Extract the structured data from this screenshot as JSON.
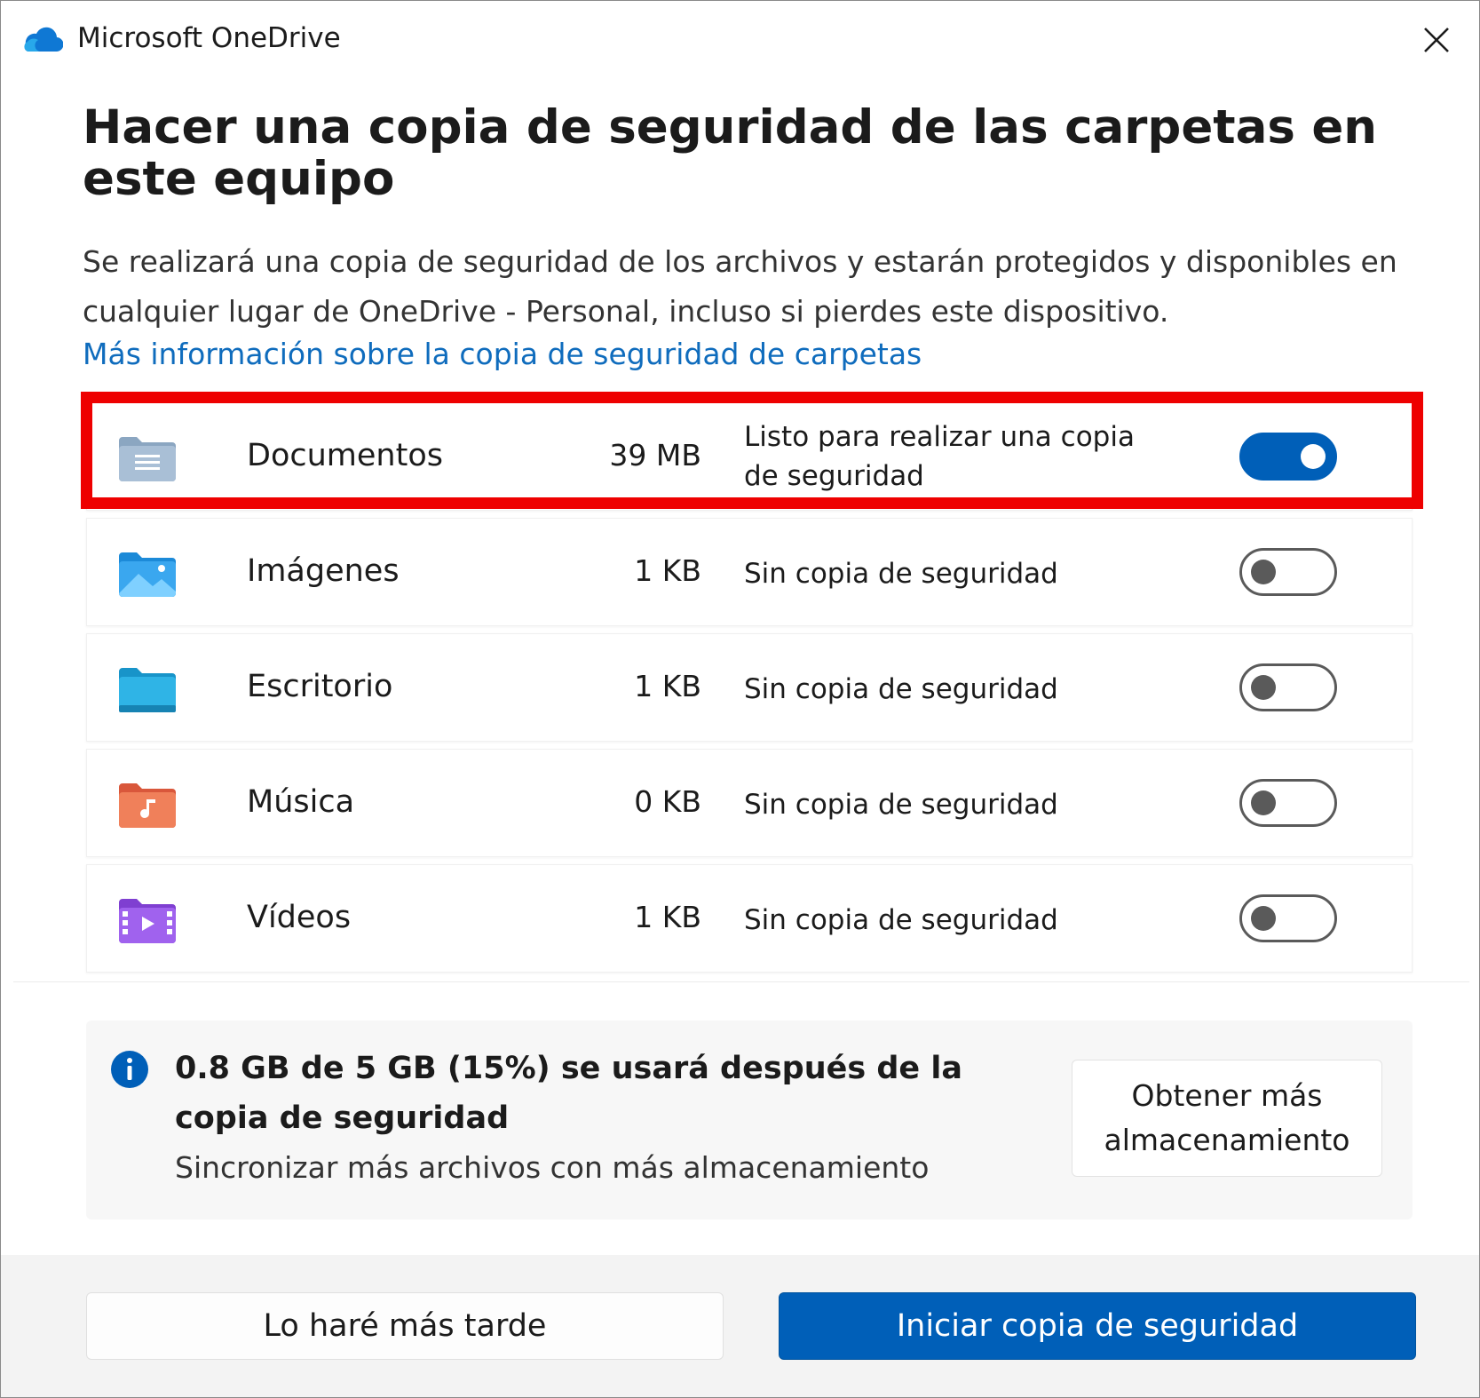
{
  "window": {
    "title": "Microsoft OneDrive",
    "close_icon": "close-icon",
    "app_icon": "onedrive-cloud-icon"
  },
  "header": {
    "title": "Hacer una copia de seguridad de las carpetas en este equipo",
    "description": "Se realizará una copia de seguridad de los archivos y estarán protegidos y disponibles en cualquier lugar de OneDrive - Personal, incluso si pierdes este dispositivo.",
    "link": "Más información sobre la copia de seguridad de carpetas"
  },
  "folders": [
    {
      "name": "Documentos",
      "size": "39 MB",
      "status": "Listo para realizar una copia de seguridad",
      "enabled": true,
      "icon": "documents-folder-icon",
      "highlighted": true
    },
    {
      "name": "Imágenes",
      "size": "1 KB",
      "status": "Sin copia de seguridad",
      "enabled": false,
      "icon": "pictures-folder-icon"
    },
    {
      "name": "Escritorio",
      "size": "1 KB",
      "status": "Sin copia de seguridad",
      "enabled": false,
      "icon": "desktop-folder-icon"
    },
    {
      "name": "Música",
      "size": "0 KB",
      "status": "Sin copia de seguridad",
      "enabled": false,
      "icon": "music-folder-icon"
    },
    {
      "name": "Vídeos",
      "size": "1 KB",
      "status": "Sin copia de seguridad",
      "enabled": false,
      "icon": "videos-folder-icon"
    }
  ],
  "storage": {
    "summary": "0.8 GB de 5 GB (15%) se usará después de la copia de seguridad",
    "hint": "Sincronizar más archivos con más almacenamiento",
    "button": "Obtener más almacenamiento",
    "icon": "info-icon"
  },
  "footer": {
    "later_button": "Lo haré más tarde",
    "start_button": "Iniciar copia de seguridad"
  },
  "colors": {
    "accent": "#005fb8",
    "link": "#0f6cbd",
    "highlight": "#ee0000"
  }
}
